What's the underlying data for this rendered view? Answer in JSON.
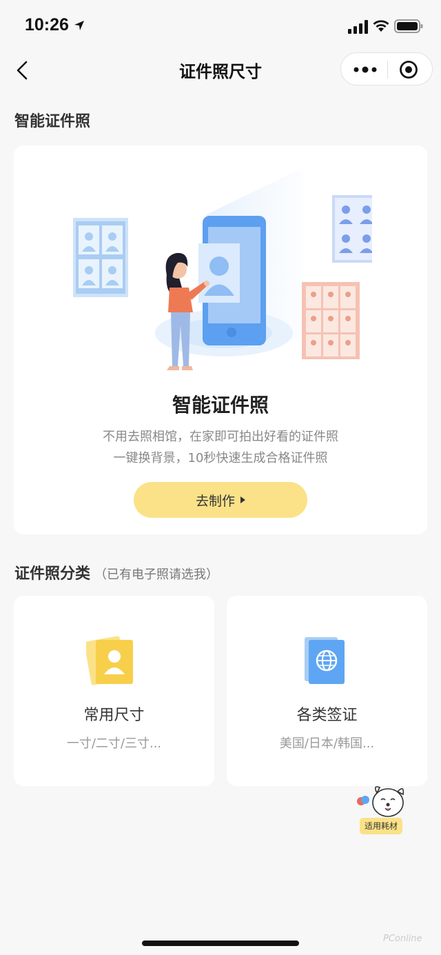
{
  "status_bar": {
    "time": "10:26"
  },
  "nav": {
    "title": "证件照尺寸"
  },
  "smart_section": {
    "title": "智能证件照"
  },
  "main_card": {
    "title": "智能证件照",
    "desc_line1": "不用去照相馆，在家即可拍出好看的证件照",
    "desc_line2": "一键换背景，10秒快速生成合格证件照",
    "button_label": "去制作"
  },
  "category_section": {
    "title": "证件照分类",
    "subtitle": "（已有电子照请选我）"
  },
  "categories": [
    {
      "title": "常用尺寸",
      "subtitle": "一寸/二寸/三寸...",
      "icon": "id-photo-icon"
    },
    {
      "title": "各类签证",
      "subtitle": "美国/日本/韩国...",
      "icon": "passport-icon"
    }
  ],
  "floating": {
    "label": "适用耗材"
  },
  "watermark": "PConline",
  "colors": {
    "accent": "#fbe288",
    "card_bg": "#ffffff",
    "page_bg": "#f7f7f7"
  }
}
